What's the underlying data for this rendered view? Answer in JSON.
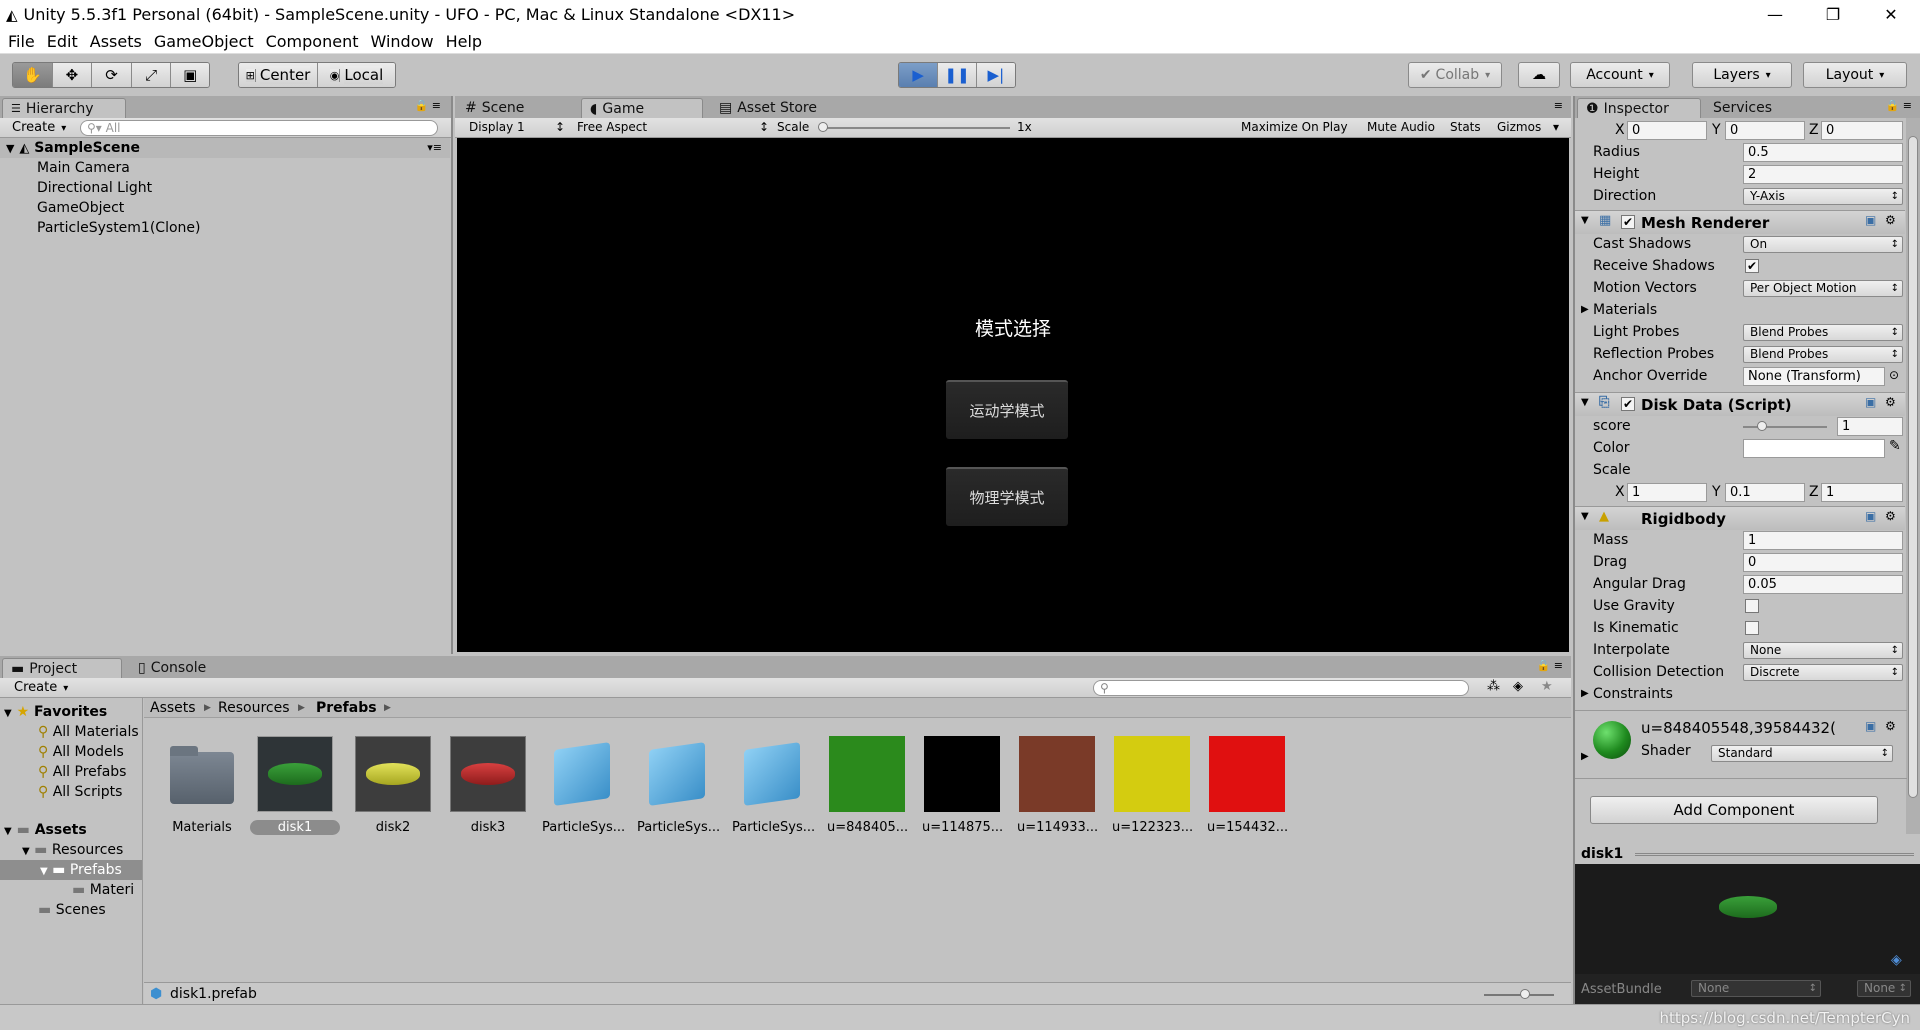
{
  "window": {
    "title": "Unity 5.5.3f1 Personal (64bit) - SampleScene.unity - UFO - PC, Mac & Linux Standalone <DX11>"
  },
  "menu": [
    "File",
    "Edit",
    "Assets",
    "GameObject",
    "Component",
    "Window",
    "Help"
  ],
  "toolbar": {
    "center": "Center",
    "local": "Local",
    "collab": "Collab",
    "account": "Account",
    "layers": "Layers",
    "layout": "Layout"
  },
  "hierarchy": {
    "tab": "Hierarchy",
    "create": "Create",
    "search_placeholder": "All",
    "scene": "SampleScene",
    "items": [
      "Main Camera",
      "Directional Light",
      "GameObject",
      "ParticleSystem1(Clone)"
    ]
  },
  "center_tabs": {
    "scene": "Scene",
    "game": "Game",
    "asset_store": "Asset Store"
  },
  "game_bar": {
    "display": "Display 1",
    "aspect": "Free Aspect",
    "scale_label": "Scale",
    "scale_value": "1x",
    "maximize": "Maximize On Play",
    "mute": "Mute Audio",
    "stats": "Stats",
    "gizmos": "Gizmos"
  },
  "game_view": {
    "title": "模式选择",
    "button1": "运动学模式",
    "button2": "物理学模式"
  },
  "inspector": {
    "tab": "Inspector",
    "services": "Services",
    "vec_top": {
      "x": "0",
      "y": "0",
      "z": "0"
    },
    "radius_label": "Radius",
    "radius": "0.5",
    "height_label": "Height",
    "height": "2",
    "direction_label": "Direction",
    "direction": "Y-Axis",
    "mesh_renderer": {
      "title": "Mesh Renderer",
      "cast_shadows_label": "Cast Shadows",
      "cast_shadows": "On",
      "receive_shadows_label": "Receive Shadows",
      "motion_vectors_label": "Motion Vectors",
      "motion_vectors": "Per Object Motion",
      "materials_label": "Materials",
      "light_probes_label": "Light Probes",
      "light_probes": "Blend Probes",
      "reflection_probes_label": "Reflection Probes",
      "reflection_probes": "Blend Probes",
      "anchor_override_label": "Anchor Override",
      "anchor_override": "None (Transform)"
    },
    "disk_data": {
      "title": "Disk Data (Script)",
      "score_label": "score",
      "score": "1",
      "color_label": "Color",
      "color": "#ffffff",
      "scale_label": "Scale",
      "scale": {
        "x": "1",
        "y": "0.1",
        "z": "1"
      }
    },
    "rigidbody": {
      "title": "Rigidbody",
      "mass_label": "Mass",
      "mass": "1",
      "drag_label": "Drag",
      "drag": "0",
      "angular_drag_label": "Angular Drag",
      "angular_drag": "0.05",
      "use_gravity_label": "Use Gravity",
      "is_kinematic_label": "Is Kinematic",
      "interpolate_label": "Interpolate",
      "interpolate": "None",
      "collision_label": "Collision Detection",
      "collision": "Discrete",
      "constraints_label": "Constraints"
    },
    "material": {
      "name": "u=848405548,39584432(",
      "shader_label": "Shader",
      "shader": "Standard"
    },
    "add_component": "Add Component",
    "preview": {
      "title": "disk1",
      "assetbundle_label": "AssetBundle",
      "bundle": "None",
      "variant": "None"
    }
  },
  "project": {
    "tab": "Project",
    "console": "Console",
    "create": "Create",
    "favorites_label": "Favorites",
    "favorites": [
      "All Materials",
      "All Models",
      "All Prefabs",
      "All Scripts"
    ],
    "assets_label": "Assets",
    "tree": [
      "Resources",
      "Prefabs",
      "Materi",
      "Scenes"
    ],
    "breadcrumb": [
      "Assets",
      "Resources",
      "Prefabs"
    ],
    "assets": [
      "Materials",
      "disk1",
      "disk2",
      "disk3",
      "ParticleSys...",
      "ParticleSys...",
      "ParticleSys...",
      "u=848405...",
      "u=114875...",
      "u=114933...",
      "u=122323...",
      "u=154432..."
    ],
    "asset_colors": [
      "#6b7784",
      "#2f7d2f",
      "#c8c83c",
      "#b83030",
      "#4ea6dc",
      "#4ea6dc",
      "#4ea6dc",
      "#2b8a1c",
      "#000000",
      "#7a3a28",
      "#d4cc10",
      "#e01010"
    ],
    "selected_file": "disk1.prefab"
  },
  "watermark": "https://blog.csdn.net/TempterCyn"
}
